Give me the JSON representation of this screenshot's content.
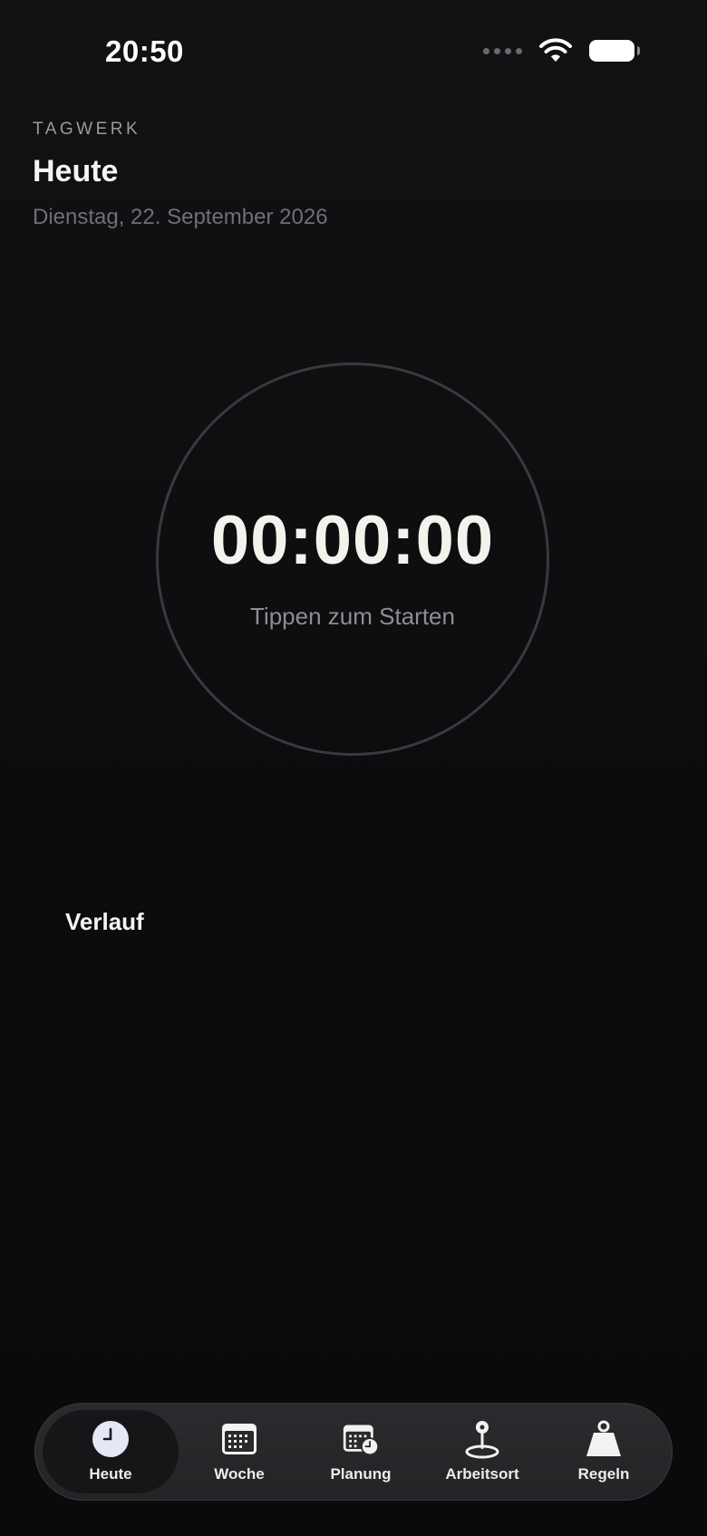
{
  "status_bar": {
    "time": "20:50"
  },
  "header": {
    "app_label": "TAGWERK",
    "title": "Heute",
    "date": "Dienstag, 22. September 2026"
  },
  "timer": {
    "value": "00:00:00",
    "hint": "Tippen zum Starten"
  },
  "history": {
    "title": "Verlauf"
  },
  "tab_bar": {
    "tabs": [
      {
        "label": "Heute",
        "icon": "clock-icon",
        "active": true
      },
      {
        "label": "Woche",
        "icon": "calendar-icon",
        "active": false
      },
      {
        "label": "Planung",
        "icon": "calendar-clock-icon",
        "active": false
      },
      {
        "label": "Arbeitsort",
        "icon": "location-pin-icon",
        "active": false
      },
      {
        "label": "Regeln",
        "icon": "weight-icon",
        "active": false
      }
    ]
  },
  "colors": {
    "background": "#0d0d0f",
    "text_primary": "#f5f5f5",
    "text_secondary": "#8e8e92",
    "ring": "#3a3a3e",
    "tab_bar": "#2b2b2e"
  }
}
